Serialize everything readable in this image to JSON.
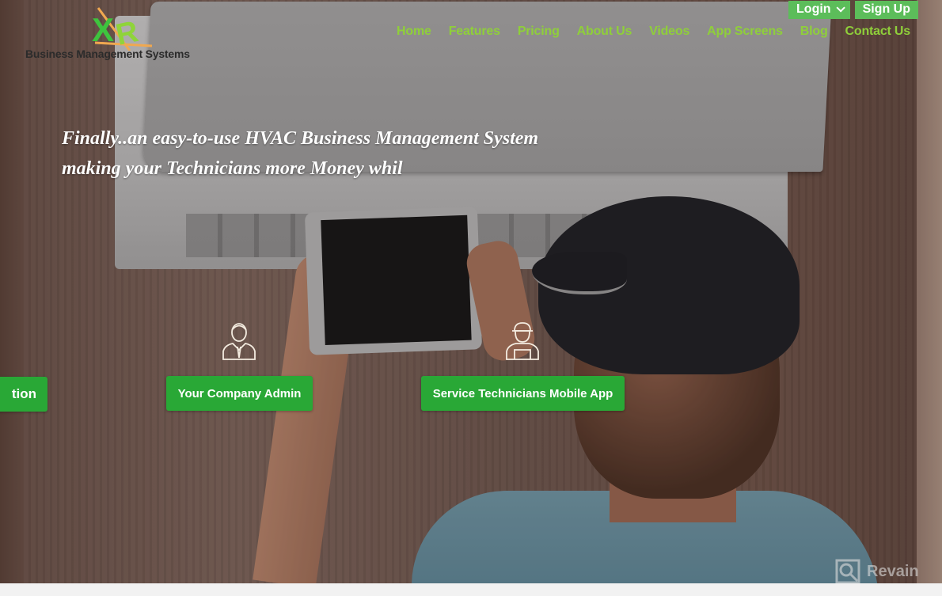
{
  "logo": {
    "mark_text": "XR",
    "tagline": "Business Management Systems"
  },
  "auth": {
    "login_label": "Login",
    "signup_label": "Sign Up"
  },
  "nav": {
    "items": [
      "Home",
      "Features",
      "Pricing",
      "About Us",
      "Videos",
      "App Screens",
      "Blog",
      "Contact Us"
    ]
  },
  "hero": {
    "headline_line1": "Finally..an easy-to-use HVAC Business Management System",
    "headline_line2": "making your Technicians more Money whil"
  },
  "ctas": {
    "partial_label": "tion",
    "admin_label": "Your Company Admin",
    "admin_icon": "businessman-icon",
    "technician_label": "Service Technicians Mobile App",
    "technician_icon": "technician-icon"
  },
  "watermark": {
    "label": "Revain"
  },
  "colors": {
    "nav_text": "#8fcf3a",
    "auth_button": "#5cbd5a",
    "cta_button": "#29a836",
    "headline": "#ffffff"
  }
}
